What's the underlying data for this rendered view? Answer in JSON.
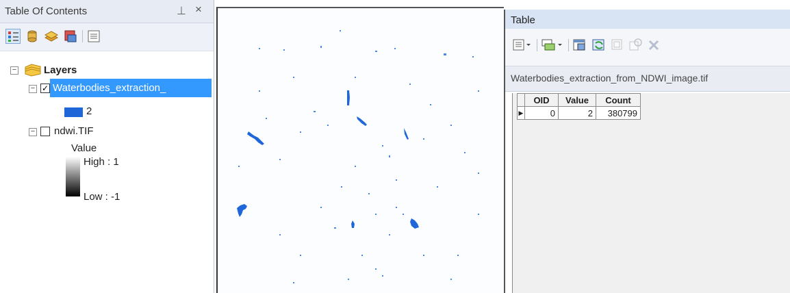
{
  "toc": {
    "title": "Table Of Contents",
    "pin_glyph": "Ѩ",
    "close_glyph": "×",
    "tools": [
      "list-by-drawing-order-icon",
      "list-by-source-icon",
      "list-by-visibility-icon",
      "list-by-selection-icon",
      "options-icon"
    ],
    "layers_label": "Layers",
    "layer1": {
      "name": "Waterbodies_extraction_",
      "checked": true,
      "legend_label": "2",
      "legend_color": "#1f66d9"
    },
    "layer2": {
      "name": "ndwi.TIF",
      "checked": false,
      "value_label": "Value",
      "high_label": "High : 1",
      "low_label": "Low : -1"
    }
  },
  "table": {
    "title": "Table",
    "tab_name": "Waterbodies_extraction_from_NDWI_image.tif",
    "columns": [
      "OID",
      "Value",
      "Count"
    ],
    "rows": [
      {
        "oid": "0",
        "value": "2",
        "count": "380799"
      }
    ]
  },
  "map": {
    "water_color": "#1f66d9"
  }
}
